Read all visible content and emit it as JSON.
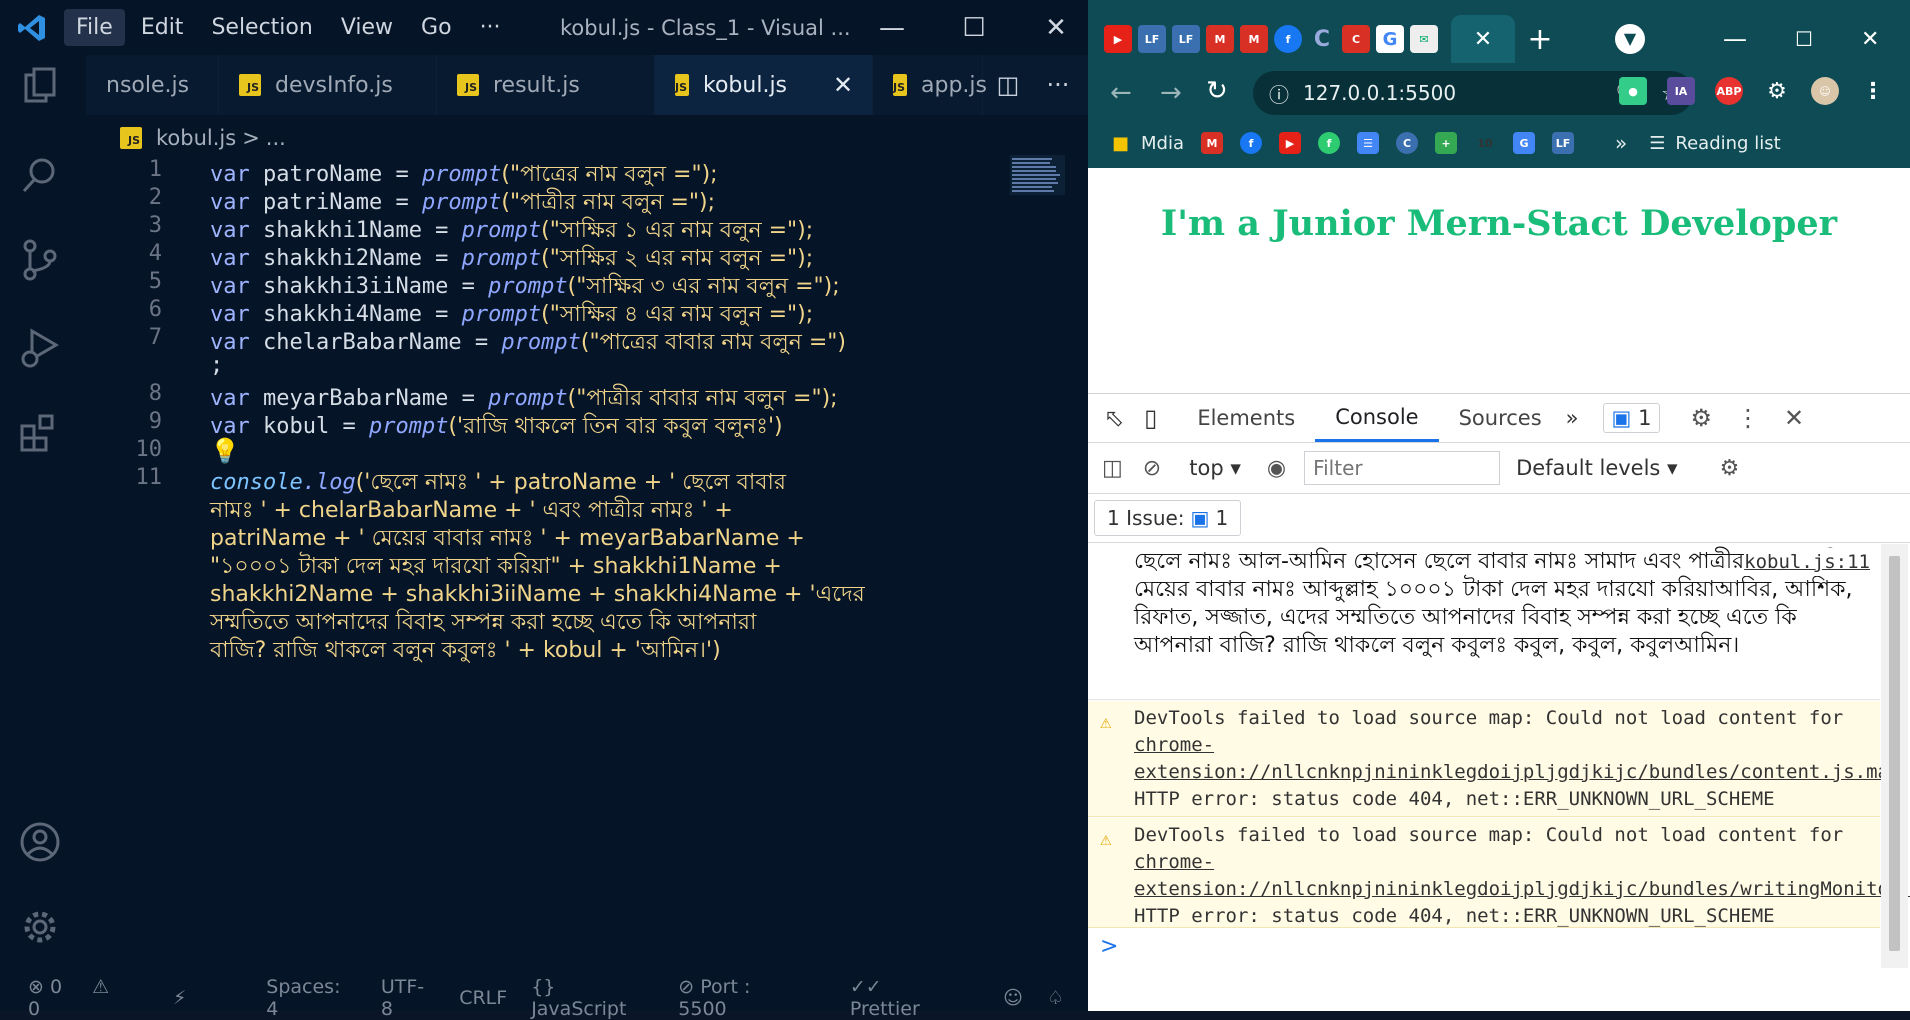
{
  "vscode": {
    "menu": [
      "File",
      "Edit",
      "Selection",
      "View",
      "Go",
      "···"
    ],
    "window_title": "kobul.js - Class_1 - Visual ...",
    "tabs": [
      {
        "label": "nsole.js",
        "icon": "js-file-icon"
      },
      {
        "label": "devsInfo.js",
        "icon": "js-file-icon"
      },
      {
        "label": "result.js",
        "icon": "js-file-icon"
      },
      {
        "label": "kobul.js",
        "icon": "js-file-icon",
        "active": true
      },
      {
        "label": "app.js",
        "icon": "js-file-icon"
      }
    ],
    "breadcrumb": {
      "file": "kobul.js",
      "sep": ">",
      "rest": "..."
    },
    "line_numbers": [
      "1",
      "2",
      "3",
      "4",
      "5",
      "6",
      "7",
      "",
      "8",
      "9",
      "10",
      "11",
      "",
      "",
      "",
      "",
      "",
      "",
      ""
    ],
    "code": {
      "l1": {
        "a": "var",
        "b": " patroName = ",
        "c": "prompt",
        "d": "(\"পাত্রের নাম বলুন =\");"
      },
      "l2": {
        "a": "var",
        "b": " patriName = ",
        "c": "prompt",
        "d": "(\"পাত্রীর নাম বলুন =\");"
      },
      "l3": {
        "a": "var",
        "b": " shakkhi1Name = ",
        "c": "prompt",
        "d": "(\"সাক্ষির ১ এর নাম বলুন =\");"
      },
      "l4": {
        "a": "var",
        "b": " shakkhi2Name = ",
        "c": "prompt",
        "d": "(\"সাক্ষির ২ এর নাম বলুন =\");"
      },
      "l5": {
        "a": "var",
        "b": " shakkhi3iiName = ",
        "c": "prompt",
        "d": "(\"সাক্ষির ৩ এর নাম বলুন =\");"
      },
      "l6": {
        "a": "var",
        "b": " shakkhi4Name = ",
        "c": "prompt",
        "d": "(\"সাক্ষির ৪ এর নাম বলুন =\");"
      },
      "l7": {
        "a": "var",
        "b": " chelarBabarName = ",
        "c": "prompt",
        "d": "(\"পাত্রের বাবার নাম বলুন =\")"
      },
      "l7b": ";",
      "l8": {
        "a": "var",
        "b": " meyarBabarName = ",
        "c": "prompt",
        "d": "(\"পাত্রীর বাবার নাম বলুন =\");"
      },
      "l9": {
        "a": "var",
        "b": " kobul = ",
        "c": "prompt",
        "d": "('রাজি থাকলে তিন বার কবুল বলুনঃ')"
      },
      "l11a": {
        "a": "console",
        "b": ".log",
        "c": "('ছেলে নামঃ ' + patroName + ' ছেলে বাবার"
      },
      "l11b": "নামঃ ' + chelarBabarName + ' এবং পাত্রীর নামঃ ' +",
      "l11c": "patriName + ' মেয়ের বাবার নামঃ ' + meyarBabarName +",
      "l11d": "\"১০০০১ টাকা দেল মহর দারযো করিয়া\" + shakkhi1Name +",
      "l11e": "shakkhi2Name + shakkhi3iiName + shakkhi4Name + 'এদের",
      "l11f": "সম্মতিতে আপনাদের বিবাহ সম্পন্ন করা হচ্ছে এতে কি আপনারা",
      "l11g": "বাজি? রাজি থাকলে বলুন কবুলঃ ' + kobul + 'আমিন।')"
    },
    "status": {
      "errors": "0",
      "warnings": "0",
      "spaces": "Spaces: 4",
      "encoding": "UTF-8",
      "eol": "CRLF",
      "language": "{} JavaScript",
      "port": "Port : 5500",
      "prettier": "Prettier"
    }
  },
  "chrome": {
    "address": "127.0.0.1:5500",
    "bookmarks": [
      "Mdia",
      "Reading list"
    ],
    "page_heading": "I'm a Junior Mern-Stact Developer",
    "devtools_tabs": [
      "Elements",
      "Console",
      "Sources"
    ],
    "issue_badge": "1",
    "context": "top",
    "filter_placeholder": "Filter",
    "levels": "Default levels",
    "issues_label": "1 Issue:",
    "issues_count": "1",
    "log_source": "kobul.js:11",
    "log_text": "ছেলে নামঃ আল-আমিন হোসেন  ছেলে বাবার নামঃ সামাদ   এবং পাত্রীর নামঃ ফারিয়া  মেয়ের বাবার নামঃ আব্দুল্লাহ ১০০০১ টাকা দেল মহর দারযো করিয়াআবির, আশিক, রিফাত, সজ্জাত, এদের সম্মতিতে আপনাদের বিবাহ সম্পন্ন করা হচ্ছে এতে কি আপনারা বাজি? রাজি থাকলে বলুন কবুলঃ কবুল, কবুল,  কবুলআমিন।",
    "warn1": {
      "pre": "DevTools failed to load source map: Could not load content for ",
      "link": "chrome-extension://nllcnknpjnininklegdoijpljgdjkijc/bundles/content.js.map",
      "post": ": HTTP error: status code 404, net::ERR_UNKNOWN_URL_SCHEME"
    },
    "warn2": {
      "pre": "DevTools failed to load source map: Could not load content for ",
      "link": "chrome-extension://nllcnknpjnininklegdoijpljgdjkijc/bundles/writingMonitor.js.map",
      "post": ": HTTP error: status code 404, net::ERR_UNKNOWN_URL_SCHEME"
    },
    "prompt": ">"
  },
  "colors": {
    "vscode_bg": "#061427",
    "accent_js": "#e8c51c",
    "heading": "#1abc7a",
    "chrome_frame": "#0e4b54",
    "devtools_blue": "#1a73e8"
  }
}
